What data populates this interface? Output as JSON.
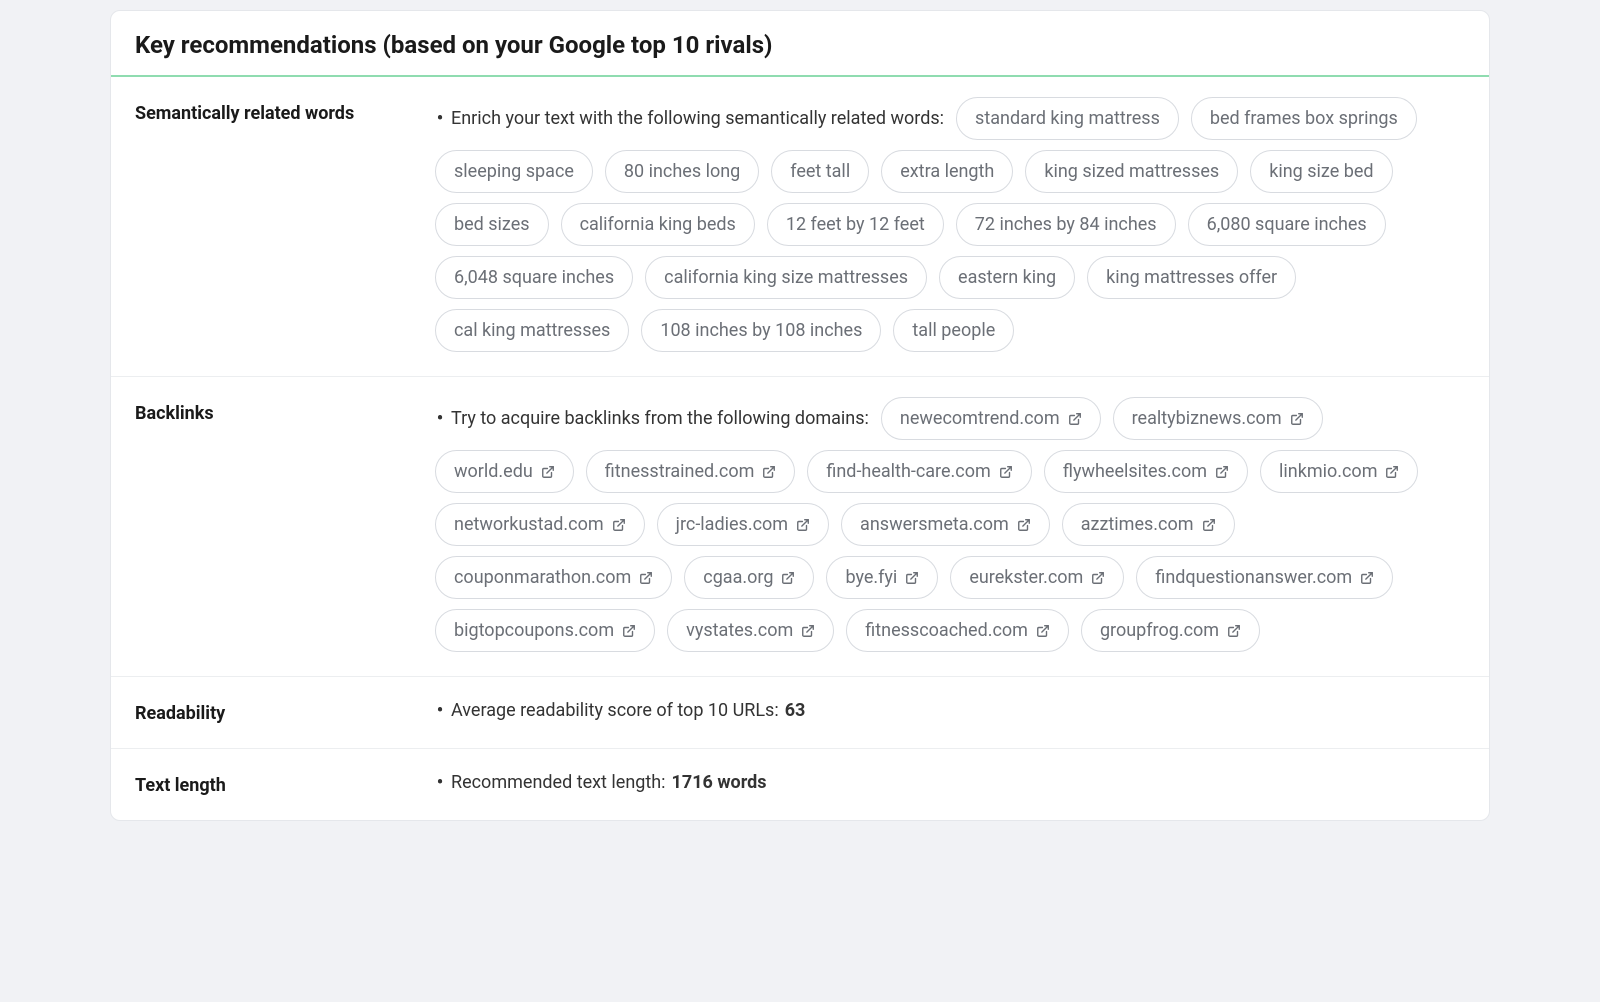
{
  "header": {
    "title": "Key recommendations (based on your Google top 10 rivals)"
  },
  "sections": {
    "semantic": {
      "label": "Semantically related words",
      "lead": "Enrich your text with the following semantically related words:",
      "pills": [
        "standard king mattress",
        "bed frames box springs",
        "sleeping space",
        "80 inches long",
        "feet tall",
        "extra length",
        "king sized mattresses",
        "king size bed",
        "bed sizes",
        "california king beds",
        "12 feet by 12 feet",
        "72 inches by 84 inches",
        "6,080 square inches",
        "6,048 square inches",
        "california king size mattresses",
        "eastern king",
        "king mattresses offer",
        "cal king mattresses",
        "108 inches by 108 inches",
        "tall people"
      ]
    },
    "backlinks": {
      "label": "Backlinks",
      "lead": "Try to acquire backlinks from the following domains:",
      "pills": [
        "newecomtrend.com",
        "realtybiznews.com",
        "world.edu",
        "fitnesstrained.com",
        "find-health-care.com",
        "flywheelsites.com",
        "linkmio.com",
        "networkustad.com",
        "jrc-ladies.com",
        "answersmeta.com",
        "azztimes.com",
        "couponmarathon.com",
        "cgaa.org",
        "bye.fyi",
        "eurekster.com",
        "findquestionanswer.com",
        "bigtopcoupons.com",
        "vystates.com",
        "fitnesscoached.com",
        "groupfrog.com"
      ]
    },
    "readability": {
      "label": "Readability",
      "lead": "Average readability score of top 10 URLs:",
      "value": "63"
    },
    "textlength": {
      "label": "Text length",
      "lead": "Recommended text length:",
      "value": "1716 words"
    }
  }
}
